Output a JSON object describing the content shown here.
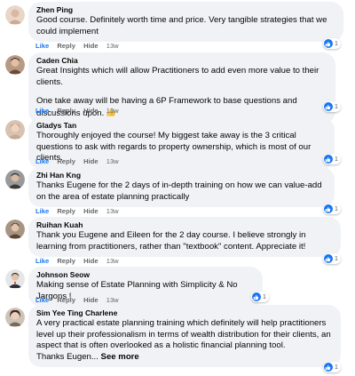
{
  "actions": {
    "like": "Like",
    "reply": "Reply",
    "hide": "Hide"
  },
  "colors": {
    "bubble": "#f0f2f5",
    "like_blue": "#1877f2",
    "meta_grey": "#65676b",
    "thumbs_emoji": "#f7b928"
  },
  "comments": [
    {
      "author": "Zhen Ping",
      "paragraphs": [
        "Good course. Definitely worth time and price. Very tangible strategies that we could implement"
      ],
      "time": "13w",
      "reactions": "1",
      "reaction_icon": "thumbs-up-icon",
      "avatar_color": "#d9b8a3"
    },
    {
      "author": "Caden Chia",
      "paragraphs": [
        "Great Insights which will allow Practitioners to add even more value to their clients.",
        "One take away will be having a 6P Framework to base questions and discussions upon."
      ],
      "emoji": "thumbs-up-emoji",
      "time": "13w",
      "reactions": "1",
      "reaction_icon": "thumbs-up-icon",
      "avatar_color": "#6b4a3a"
    },
    {
      "author": "Gladys Tan",
      "paragraphs": [
        "Thoroughly enjoyed the course! My biggest take away is the 3 critical questions to ask with regards to property ownership, which is most of our clients."
      ],
      "time": "13w",
      "reactions": "1",
      "reaction_icon": "thumbs-up-icon",
      "avatar_color": "#c9a98e"
    },
    {
      "author": "Zhi Han Kng",
      "paragraphs": [
        "Thanks Eugene for the 2 days of in-depth training on how we can value-add on the area of estate planning practically"
      ],
      "time": "13w",
      "reactions": "1",
      "reaction_icon": "thumbs-up-icon",
      "avatar_color": "#3a3a3a"
    },
    {
      "author": "Ruihan Kuah",
      "paragraphs": [
        "Thank you Eugene and Eileen for the 2 day course. I believe strongly in learning from practitioners, rather than \"textbook\" content. Appreciate it!"
      ],
      "time": "13w",
      "reactions": "1",
      "reaction_icon": "thumbs-up-icon",
      "avatar_color": "#5a4636"
    },
    {
      "author": "Johnson Seow",
      "paragraphs": [
        "Making sense of Estate Planning with Simplicity & No Jargons !"
      ],
      "time": "13w",
      "reactions": "1",
      "reaction_icon": "thumbs-up-icon",
      "avatar_color": "#2a2f3a"
    },
    {
      "author": "Sim Yee Ting Charlene",
      "paragraphs": [
        "A very practical estate planning training which definitely will help practitioners level up their professionalism in terms of wealth distribution for their clients, an aspect that is often overlooked as a holistic financial planning tool."
      ],
      "tail": "Thanks Eugen...",
      "see_more": "See more",
      "time": "13w",
      "reactions": "1",
      "reaction_icon": "thumbs-up-icon",
      "avatar_color": "#7a6a5e"
    }
  ]
}
